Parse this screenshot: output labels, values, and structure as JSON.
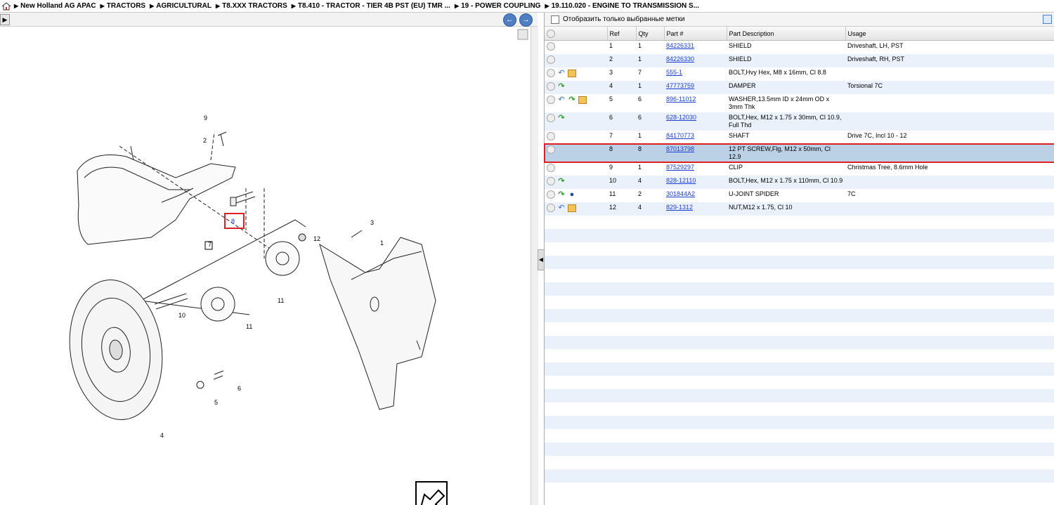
{
  "breadcrumb": [
    "New Holland AG APAC",
    "TRACTORS",
    "AGRICULTURAL",
    "T8.XXX TRACTORS",
    "T8.410 - TRACTOR - TIER 4B PST (EU) TMR ...",
    "19 - POWER COUPLING",
    "19.110.020 - ENGINE TO TRANSMISSION S..."
  ],
  "nav": {
    "back": "←",
    "forward": "→"
  },
  "filter": {
    "label": "Отобразить только выбранные метки"
  },
  "table": {
    "headers": {
      "ref": "Ref",
      "qty": "Qty",
      "part": "Part #",
      "desc": "Part Description",
      "usage": "Usage"
    },
    "rows": [
      {
        "ref": "1",
        "qty": "1",
        "part": "84226331",
        "desc": "SHIELD",
        "usage": "Driveshaft, LH, PST",
        "icons": []
      },
      {
        "ref": "2",
        "qty": "1",
        "part": "84226330",
        "desc": "SHIELD",
        "usage": "Driveshaft, RH, PST",
        "icons": []
      },
      {
        "ref": "3",
        "qty": "7",
        "part": "555-1",
        "desc": "BOLT,Hvy Hex, M8 x 16mm, Cl 8.8",
        "usage": "",
        "icons": [
          "undo",
          "box"
        ]
      },
      {
        "ref": "4",
        "qty": "1",
        "part": "47773759",
        "desc": "DAMPER",
        "usage": "Torsional 7C",
        "icons": [
          "redo"
        ]
      },
      {
        "ref": "5",
        "qty": "6",
        "part": "896-11012",
        "desc": "WASHER,13.5mm ID x 24mm OD x 3mm Thk",
        "usage": "",
        "icons": [
          "undo",
          "redo",
          "box"
        ]
      },
      {
        "ref": "6",
        "qty": "6",
        "part": "628-12030",
        "desc": "BOLT,Hex, M12 x 1.75 x 30mm, Cl 10.9, Full Thd",
        "usage": "",
        "icons": [
          "redo"
        ]
      },
      {
        "ref": "7",
        "qty": "1",
        "part": "84170773",
        "desc": "SHAFT",
        "usage": "Drive 7C, Incl 10 - 12",
        "icons": []
      },
      {
        "ref": "8",
        "qty": "8",
        "part": "87013798",
        "desc": "12 PT SCREW,Flg, M12 x 50mm, Cl 12.9",
        "usage": "",
        "icons": [],
        "selected": true
      },
      {
        "ref": "9",
        "qty": "1",
        "part": "87529297",
        "desc": "CLIP",
        "usage": "Christmas Tree, 8.6mm Hole",
        "icons": []
      },
      {
        "ref": "10",
        "qty": "4",
        "part": "828-12110",
        "desc": "BOLT,Hex, M12 x 1.75 x 110mm, Cl 10.9",
        "usage": "",
        "icons": [
          "redo"
        ]
      },
      {
        "ref": "11",
        "qty": "2",
        "part": "301844A2",
        "desc": "U-JOINT SPIDER",
        "usage": "7C",
        "icons": [
          "redo",
          "globe"
        ]
      },
      {
        "ref": "12",
        "qty": "4",
        "part": "829-1312",
        "desc": "NUT,M12 x 1.75, Cl 10",
        "usage": "",
        "icons": [
          "undo",
          "box"
        ]
      }
    ]
  },
  "diagram": {
    "callouts": [
      "1",
      "2",
      "3",
      "4",
      "5",
      "6",
      "7",
      "8",
      "9",
      "10",
      "11",
      "11",
      "12"
    ],
    "highlighted_callout": "8"
  }
}
